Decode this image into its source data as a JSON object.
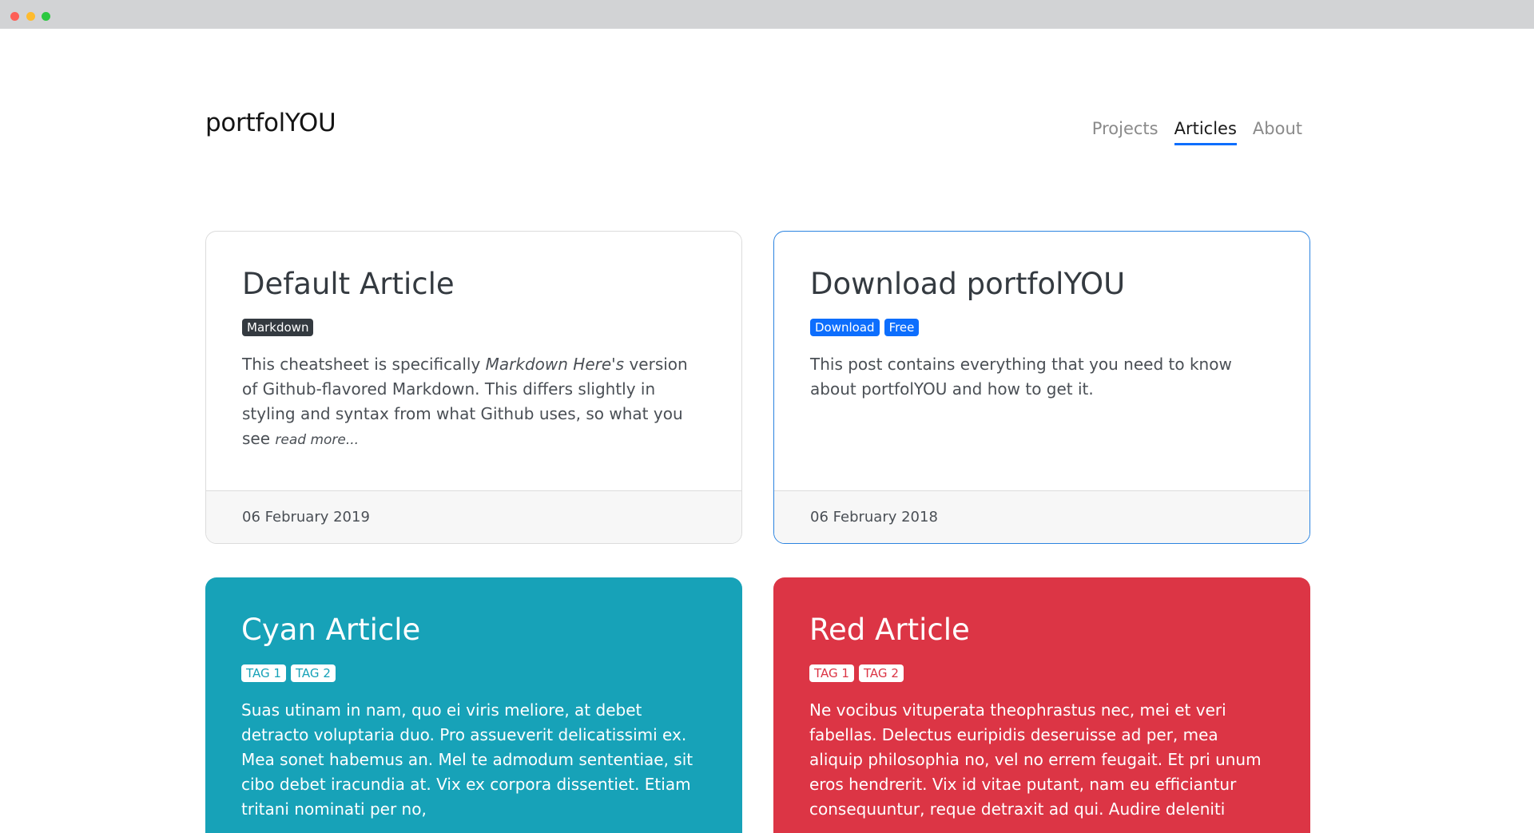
{
  "site": {
    "brand": "portfolYOU",
    "nav": [
      {
        "label": "Projects",
        "active": false
      },
      {
        "label": "Articles",
        "active": true
      },
      {
        "label": "About",
        "active": false
      }
    ]
  },
  "articles": [
    {
      "title": "Default Article",
      "tags": [
        "Markdown"
      ],
      "excerpt_before": "This cheatsheet is specifically ",
      "excerpt_em": "Markdown Here's",
      "excerpt_after": " version of Github-flavored Markdown. This differs slightly in styling and syntax from what Github uses, so what you see ",
      "read_more": "read more...",
      "date": "06 February 2019"
    },
    {
      "title": "Download portfolYOU",
      "tags": [
        "Download",
        "Free"
      ],
      "excerpt": "This post contains everything that you need to know about portfolYOU and how to get it.",
      "date": "06 February 2018"
    },
    {
      "title": "Cyan Article",
      "tags": [
        "TAG 1",
        "TAG 2"
      ],
      "excerpt": "Suas utinam in nam, quo ei viris meliore, at debet detracto voluptaria duo. Pro assueverit delicatissimi ex. Mea sonet habemus an. Mel te admodum sententiae, sit cibo debet iracundia at. Vix ex corpora dissentiet. Etiam tritani nominati per no,"
    },
    {
      "title": "Red Article",
      "tags": [
        "TAG 1",
        "TAG 2"
      ],
      "excerpt": "Ne vocibus vituperata theophrastus nec, mei et veri fabellas. Delectus euripidis deseruisse ad per, mea aliquip philosophia no, vel no errem feugait. Et pri unum eros hendrerit. Vix id vitae putant, nam eu efficiantur consequuntur, reque detraxit ad qui. Audire deleniti"
    }
  ],
  "colors": {
    "nav_active_underline": "#0d6efd",
    "cyan": "#17a2b8",
    "red": "#dc3545",
    "badge_dark": "#343a40",
    "badge_blue": "#0d6efd"
  }
}
